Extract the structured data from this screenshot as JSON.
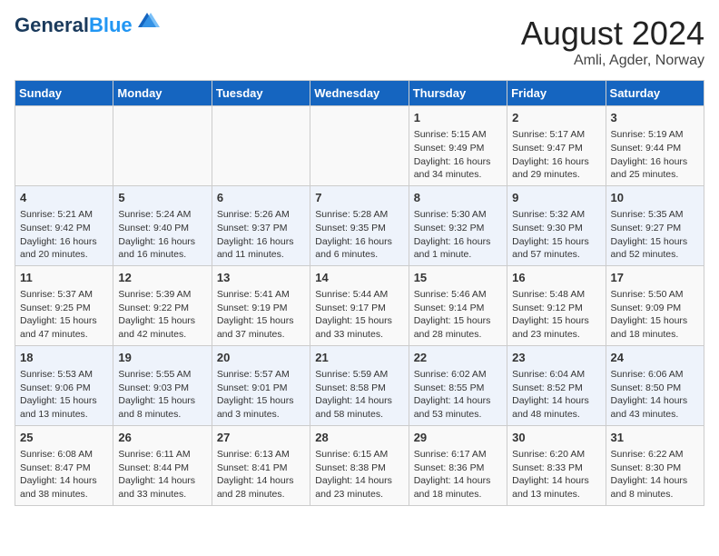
{
  "header": {
    "logo_line1": "General",
    "logo_line2": "Blue",
    "title": "August 2024",
    "subtitle": "Amli, Agder, Norway"
  },
  "days_of_week": [
    "Sunday",
    "Monday",
    "Tuesday",
    "Wednesday",
    "Thursday",
    "Friday",
    "Saturday"
  ],
  "weeks": [
    [
      {
        "day": "",
        "content": ""
      },
      {
        "day": "",
        "content": ""
      },
      {
        "day": "",
        "content": ""
      },
      {
        "day": "",
        "content": ""
      },
      {
        "day": "1",
        "content": "Sunrise: 5:15 AM\nSunset: 9:49 PM\nDaylight: 16 hours\nand 34 minutes."
      },
      {
        "day": "2",
        "content": "Sunrise: 5:17 AM\nSunset: 9:47 PM\nDaylight: 16 hours\nand 29 minutes."
      },
      {
        "day": "3",
        "content": "Sunrise: 5:19 AM\nSunset: 9:44 PM\nDaylight: 16 hours\nand 25 minutes."
      }
    ],
    [
      {
        "day": "4",
        "content": "Sunrise: 5:21 AM\nSunset: 9:42 PM\nDaylight: 16 hours\nand 20 minutes."
      },
      {
        "day": "5",
        "content": "Sunrise: 5:24 AM\nSunset: 9:40 PM\nDaylight: 16 hours\nand 16 minutes."
      },
      {
        "day": "6",
        "content": "Sunrise: 5:26 AM\nSunset: 9:37 PM\nDaylight: 16 hours\nand 11 minutes."
      },
      {
        "day": "7",
        "content": "Sunrise: 5:28 AM\nSunset: 9:35 PM\nDaylight: 16 hours\nand 6 minutes."
      },
      {
        "day": "8",
        "content": "Sunrise: 5:30 AM\nSunset: 9:32 PM\nDaylight: 16 hours\nand 1 minute."
      },
      {
        "day": "9",
        "content": "Sunrise: 5:32 AM\nSunset: 9:30 PM\nDaylight: 15 hours\nand 57 minutes."
      },
      {
        "day": "10",
        "content": "Sunrise: 5:35 AM\nSunset: 9:27 PM\nDaylight: 15 hours\nand 52 minutes."
      }
    ],
    [
      {
        "day": "11",
        "content": "Sunrise: 5:37 AM\nSunset: 9:25 PM\nDaylight: 15 hours\nand 47 minutes."
      },
      {
        "day": "12",
        "content": "Sunrise: 5:39 AM\nSunset: 9:22 PM\nDaylight: 15 hours\nand 42 minutes."
      },
      {
        "day": "13",
        "content": "Sunrise: 5:41 AM\nSunset: 9:19 PM\nDaylight: 15 hours\nand 37 minutes."
      },
      {
        "day": "14",
        "content": "Sunrise: 5:44 AM\nSunset: 9:17 PM\nDaylight: 15 hours\nand 33 minutes."
      },
      {
        "day": "15",
        "content": "Sunrise: 5:46 AM\nSunset: 9:14 PM\nDaylight: 15 hours\nand 28 minutes."
      },
      {
        "day": "16",
        "content": "Sunrise: 5:48 AM\nSunset: 9:12 PM\nDaylight: 15 hours\nand 23 minutes."
      },
      {
        "day": "17",
        "content": "Sunrise: 5:50 AM\nSunset: 9:09 PM\nDaylight: 15 hours\nand 18 minutes."
      }
    ],
    [
      {
        "day": "18",
        "content": "Sunrise: 5:53 AM\nSunset: 9:06 PM\nDaylight: 15 hours\nand 13 minutes."
      },
      {
        "day": "19",
        "content": "Sunrise: 5:55 AM\nSunset: 9:03 PM\nDaylight: 15 hours\nand 8 minutes."
      },
      {
        "day": "20",
        "content": "Sunrise: 5:57 AM\nSunset: 9:01 PM\nDaylight: 15 hours\nand 3 minutes."
      },
      {
        "day": "21",
        "content": "Sunrise: 5:59 AM\nSunset: 8:58 PM\nDaylight: 14 hours\nand 58 minutes."
      },
      {
        "day": "22",
        "content": "Sunrise: 6:02 AM\nSunset: 8:55 PM\nDaylight: 14 hours\nand 53 minutes."
      },
      {
        "day": "23",
        "content": "Sunrise: 6:04 AM\nSunset: 8:52 PM\nDaylight: 14 hours\nand 48 minutes."
      },
      {
        "day": "24",
        "content": "Sunrise: 6:06 AM\nSunset: 8:50 PM\nDaylight: 14 hours\nand 43 minutes."
      }
    ],
    [
      {
        "day": "25",
        "content": "Sunrise: 6:08 AM\nSunset: 8:47 PM\nDaylight: 14 hours\nand 38 minutes."
      },
      {
        "day": "26",
        "content": "Sunrise: 6:11 AM\nSunset: 8:44 PM\nDaylight: 14 hours\nand 33 minutes."
      },
      {
        "day": "27",
        "content": "Sunrise: 6:13 AM\nSunset: 8:41 PM\nDaylight: 14 hours\nand 28 minutes."
      },
      {
        "day": "28",
        "content": "Sunrise: 6:15 AM\nSunset: 8:38 PM\nDaylight: 14 hours\nand 23 minutes."
      },
      {
        "day": "29",
        "content": "Sunrise: 6:17 AM\nSunset: 8:36 PM\nDaylight: 14 hours\nand 18 minutes."
      },
      {
        "day": "30",
        "content": "Sunrise: 6:20 AM\nSunset: 8:33 PM\nDaylight: 14 hours\nand 13 minutes."
      },
      {
        "day": "31",
        "content": "Sunrise: 6:22 AM\nSunset: 8:30 PM\nDaylight: 14 hours\nand 8 minutes."
      }
    ]
  ]
}
